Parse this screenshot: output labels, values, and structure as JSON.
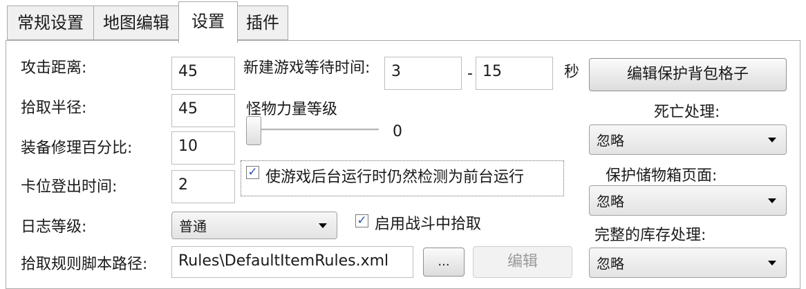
{
  "tabs": [
    "常规设置",
    "地图编辑",
    "设置",
    "插件"
  ],
  "labels": {
    "attack_distance": "攻击距离:",
    "pickup_radius": "拾取半径:",
    "repair_percent": "装备修理百分比:",
    "stuck_logout": "卡位登出时间:",
    "log_level": "日志等级:",
    "pickup_rules_path": "拾取规则脚本路径:",
    "new_game_wait": "新建游戏等待时间:",
    "dash": "-",
    "seconds": "秒",
    "monster_power": "怪物力量等级",
    "death_handling": "死亡处理:",
    "protect_stash_pages": "保护储物箱页面:",
    "full_inventory": "完整的库存处理:"
  },
  "values": {
    "attack_distance": "45",
    "pickup_radius": "45",
    "repair_percent": "10",
    "stuck_logout": "2",
    "wait_min": "3",
    "wait_max": "15",
    "monster_power": "0",
    "monster_power_level": 0,
    "log_level": "普通",
    "pickup_rules_path": "Rules\\DefaultItemRules.xml",
    "death_handling": "忽略",
    "protect_stash_pages": "忽略",
    "full_inventory": "忽略"
  },
  "checkboxes": {
    "background_as_foreground": {
      "label": "使游戏后台运行时仍然检测为前台运行",
      "checked": true,
      "mark": "✓"
    },
    "pickup_in_combat": {
      "label": "启用战斗中拾取",
      "checked": true,
      "mark": "✓"
    }
  },
  "buttons": {
    "edit_protected_bag": "编辑保护背包格子",
    "browse": "...",
    "edit": "编辑"
  }
}
